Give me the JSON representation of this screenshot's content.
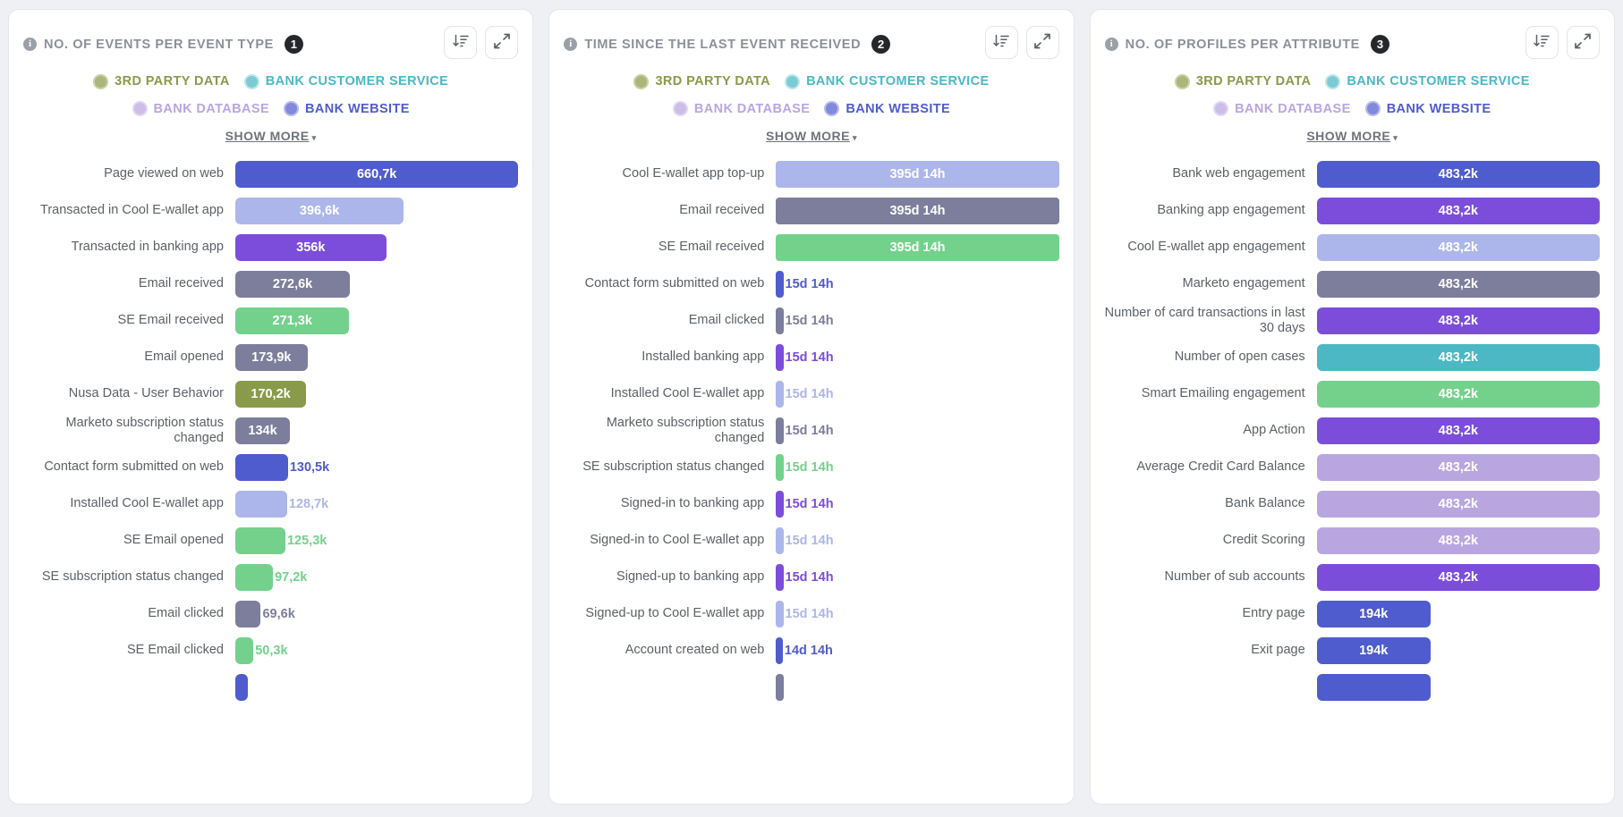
{
  "colors": {
    "third_party_data": "#8a9a4b",
    "bank_customer_service": "#4bb8c4",
    "bank_database": "#b9a6e0",
    "bank_website": "#4f5ccd",
    "blue_light": "#adb6ea",
    "purple": "#7c4ddb",
    "grey_purple": "#7d7d9c",
    "green": "#74d18c",
    "panel_border": "#e3e6ea",
    "label_text": "#5c6166",
    "title_text": "#8b9097"
  },
  "legend": {
    "items": [
      {
        "label": "3RD PARTY DATA",
        "color": "#8a9a4b",
        "ring": "#b5c179"
      },
      {
        "label": "BANK CUSTOMER SERVICE",
        "color": "#4bb8c4",
        "ring": "#a5dde3"
      },
      {
        "label": "BANK DATABASE",
        "color": "#b9a6e0",
        "ring": "#d6c9ee"
      },
      {
        "label": "BANK WEBSITE",
        "color": "#4f5ccd",
        "ring": "#9aa1e3"
      }
    ],
    "show_more": "SHOW MORE",
    "caret": "▾"
  },
  "icons": {
    "info": "i",
    "sort_descending": "sort-descending-icon",
    "expand": "expand-icon"
  },
  "panels": [
    {
      "title": "NO. OF EVENTS PER EVENT TYPE",
      "badge": "1",
      "chart_data": {
        "type": "bar",
        "title": "No. of events per event type",
        "xlabel": "",
        "ylabel": "",
        "orientation": "horizontal",
        "value_suffix": "",
        "categories": [
          "Page viewed on web",
          "Transacted in Cool E-wallet app",
          "Transacted in banking app",
          "Email received",
          "SE Email received",
          "Email opened",
          "Nusa Data - User Behavior",
          "Marketo subscription status changed",
          "Contact form submitted on web",
          "Installed Cool E-wallet app",
          "SE Email opened",
          "SE subscription status changed",
          "Email clicked",
          "SE Email clicked"
        ],
        "values": [
          660700,
          396600,
          356000,
          272600,
          271300,
          173900,
          170200,
          134000,
          130500,
          128700,
          125300,
          97200,
          69600,
          50300
        ],
        "labels": [
          "660,7k",
          "396,6k",
          "356k",
          "272,6k",
          "271,3k",
          "173,9k",
          "170,2k",
          "134k",
          "130,5k",
          "128,7k",
          "125,3k",
          "97,2k",
          "69,6k",
          "50,3k"
        ],
        "bar_colors": [
          "#4f5ccd",
          "#adb6ea",
          "#7c4ddb",
          "#7d7d9c",
          "#74d18c",
          "#7d7d9c",
          "#8a9a4b",
          "#7d7d9c",
          "#4f5ccd",
          "#adb6ea",
          "#74d18c",
          "#74d18c",
          "#7d7d9c",
          "#74d18c"
        ],
        "value_inside": [
          true,
          true,
          true,
          true,
          true,
          true,
          true,
          true,
          false,
          false,
          false,
          false,
          false,
          false
        ],
        "widths_pct": [
          100,
          59.5,
          53.3,
          40.5,
          40.3,
          25.5,
          25.0,
          19.3,
          18.6,
          18.3,
          17.7,
          13.3,
          9.0,
          6.4
        ],
        "partial_last_row": {
          "color": "#4f5ccd",
          "width_pct": 4.5
        }
      }
    },
    {
      "title": "TIME SINCE THE LAST EVENT RECEIVED",
      "badge": "2",
      "chart_data": {
        "type": "bar",
        "title": "Time since the last event received",
        "xlabel": "",
        "ylabel": "",
        "orientation": "horizontal",
        "value_suffix": "",
        "categories": [
          "Cool E-wallet app top-up",
          "Email received",
          "SE Email received",
          "Contact form submitted on web",
          "Email clicked",
          "Installed banking app",
          "Installed Cool E-wallet app",
          "Marketo subscription status changed",
          "SE subscription status changed",
          "Signed-in to banking app",
          "Signed-in to Cool E-wallet app",
          "Signed-up to banking app",
          "Signed-up to Cool E-wallet app",
          "Account created on web"
        ],
        "values": [
          395.58,
          395.58,
          395.58,
          15.58,
          15.58,
          15.58,
          15.58,
          15.58,
          15.58,
          15.58,
          15.58,
          15.58,
          15.58,
          14.58
        ],
        "labels": [
          "395d 14h",
          "395d 14h",
          "395d 14h",
          "15d 14h",
          "15d 14h",
          "15d 14h",
          "15d 14h",
          "15d 14h",
          "15d 14h",
          "15d 14h",
          "15d 14h",
          "15d 14h",
          "15d 14h",
          "14d 14h"
        ],
        "bar_colors": [
          "#adb6ea",
          "#7d7d9c",
          "#74d18c",
          "#4f5ccd",
          "#7d7d9c",
          "#7c4ddb",
          "#adb6ea",
          "#7d7d9c",
          "#74d18c",
          "#7c4ddb",
          "#adb6ea",
          "#7c4ddb",
          "#adb6ea",
          "#4f5ccd"
        ],
        "value_inside": [
          true,
          true,
          true,
          false,
          false,
          false,
          false,
          false,
          false,
          false,
          false,
          false,
          false,
          false
        ],
        "widths_pct": [
          100,
          100,
          100,
          2.6,
          2.6,
          2.6,
          2.6,
          2.6,
          2.6,
          2.6,
          2.6,
          2.6,
          2.6,
          2.4
        ],
        "partial_last_row": {
          "color": "#7d7d9c",
          "width_pct": 2.6
        }
      }
    },
    {
      "title": "NO. OF PROFILES PER ATTRIBUTE",
      "badge": "3",
      "chart_data": {
        "type": "bar",
        "title": "No. of profiles per attribute",
        "xlabel": "",
        "ylabel": "",
        "orientation": "horizontal",
        "value_suffix": "",
        "categories": [
          "Bank web engagement",
          "Banking app engagement",
          "Cool E-wallet app engagement",
          "Marketo engagement",
          "Number of card transactions in last 30 days",
          "Number of open cases",
          "Smart Emailing engagement",
          "App Action",
          "Average Credit Card Balance",
          "Bank Balance",
          "Credit Scoring",
          "Number of sub accounts",
          "Entry page",
          "Exit page"
        ],
        "values": [
          483200,
          483200,
          483200,
          483200,
          483200,
          483200,
          483200,
          483200,
          483200,
          483200,
          483200,
          483200,
          194000,
          194000
        ],
        "labels": [
          "483,2k",
          "483,2k",
          "483,2k",
          "483,2k",
          "483,2k",
          "483,2k",
          "483,2k",
          "483,2k",
          "483,2k",
          "483,2k",
          "483,2k",
          "483,2k",
          "194k",
          "194k"
        ],
        "bar_colors": [
          "#4f5ccd",
          "#7c4ddb",
          "#adb6ea",
          "#7d7d9c",
          "#7c4ddb",
          "#4bb8c4",
          "#74d18c",
          "#7c4ddb",
          "#b9a6e0",
          "#b9a6e0",
          "#b9a6e0",
          "#7c4ddb",
          "#4f5ccd",
          "#4f5ccd"
        ],
        "value_inside": [
          true,
          true,
          true,
          true,
          true,
          true,
          true,
          true,
          true,
          true,
          true,
          true,
          true,
          true
        ],
        "widths_pct": [
          100,
          100,
          100,
          100,
          100,
          100,
          100,
          100,
          100,
          100,
          100,
          100,
          40.2,
          40.2
        ],
        "partial_last_row": {
          "color": "#4f5ccd",
          "width_pct": 40.2
        }
      }
    }
  ]
}
